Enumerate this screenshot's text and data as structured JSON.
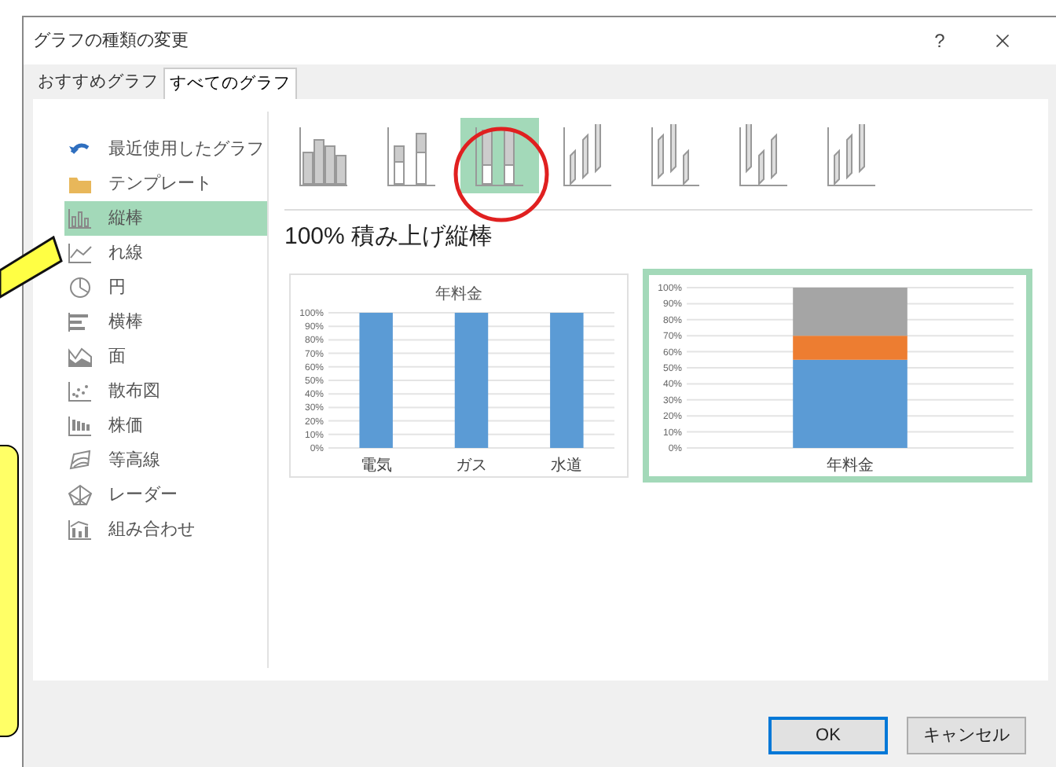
{
  "window": {
    "title": "グラフの種類の変更",
    "help": "?"
  },
  "tabs": [
    {
      "label": "おすすめグラフ",
      "selected": false
    },
    {
      "label": "すべてのグラフ",
      "selected": true
    }
  ],
  "sidebar": {
    "items": [
      {
        "label": "最近使用したグラフ",
        "selected": false
      },
      {
        "label": "テンプレート",
        "selected": false
      },
      {
        "label": "縦棒",
        "selected": true
      },
      {
        "label": "れ線",
        "selected": false
      },
      {
        "label": "円",
        "selected": false
      },
      {
        "label": "横棒",
        "selected": false
      },
      {
        "label": "面",
        "selected": false
      },
      {
        "label": "散布図",
        "selected": false
      },
      {
        "label": "株価",
        "selected": false
      },
      {
        "label": "等高線",
        "selected": false
      },
      {
        "label": "レーダー",
        "selected": false
      },
      {
        "label": "組み合わせ",
        "selected": false
      }
    ]
  },
  "chart_types": [
    {
      "selected": false
    },
    {
      "selected": false
    },
    {
      "selected": true
    },
    {
      "selected": false
    },
    {
      "selected": false
    },
    {
      "selected": false
    },
    {
      "selected": false
    }
  ],
  "preview_title": "100% 積み上げ縦棒",
  "previews": [
    {
      "selected": false,
      "chart_data": {
        "type": "bar",
        "grid": true,
        "title": "年料金",
        "categories": [
          "電気",
          "ガス",
          "水道"
        ],
        "series": [
          {
            "color": "#5b9bd5",
            "values": [
              100,
              100,
              100
            ]
          }
        ],
        "ylim": [
          0,
          100
        ],
        "yticks": [
          {
            "value": 0,
            "label": "0%"
          },
          {
            "value": 10,
            "label": "10%"
          },
          {
            "value": 20,
            "label": "20%"
          },
          {
            "value": 30,
            "label": "30%"
          },
          {
            "value": 40,
            "label": "40%"
          },
          {
            "value": 50,
            "label": "50%"
          },
          {
            "value": 60,
            "label": "60%"
          },
          {
            "value": 70,
            "label": "70%"
          },
          {
            "value": 80,
            "label": "80%"
          },
          {
            "value": 90,
            "label": "90%"
          },
          {
            "value": 100,
            "label": "100%"
          }
        ]
      }
    },
    {
      "selected": true,
      "chart_data": {
        "type": "bar",
        "grid": true,
        "categories": [
          "年料金"
        ],
        "stacked": true,
        "series": [
          {
            "color": "#5b9bd5",
            "values": [
              55
            ]
          },
          {
            "color": "#ed7d31",
            "values": [
              15
            ]
          },
          {
            "color": "#a5a5a5",
            "values": [
              30
            ]
          }
        ],
        "ylim": [
          0,
          100
        ],
        "yticks": [
          {
            "value": 0,
            "label": "0%"
          },
          {
            "value": 10,
            "label": "10%"
          },
          {
            "value": 20,
            "label": "20%"
          },
          {
            "value": 30,
            "label": "30%"
          },
          {
            "value": 40,
            "label": "40%"
          },
          {
            "value": 50,
            "label": "50%"
          },
          {
            "value": 60,
            "label": "60%"
          },
          {
            "value": 70,
            "label": "70%"
          },
          {
            "value": 80,
            "label": "80%"
          },
          {
            "value": 90,
            "label": "90%"
          },
          {
            "value": 100,
            "label": "100%"
          }
        ]
      }
    }
  ],
  "buttons": [
    {
      "label": "OK",
      "default": true
    },
    {
      "label": "キャンセル",
      "default": false
    }
  ]
}
